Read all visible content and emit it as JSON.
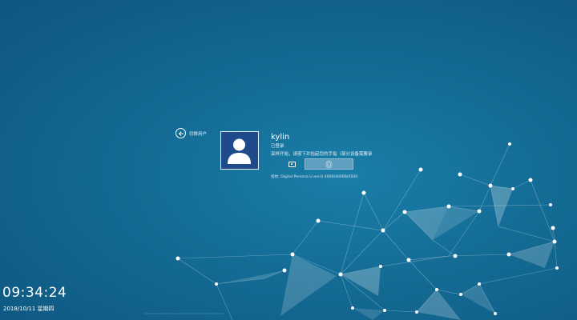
{
  "login": {
    "switch_user": "切换用户",
    "username": "kylin",
    "status": "已登录",
    "prompt": "采样开始，请按下并抬起您的手指（部分设备需要录",
    "device": "指纹: Digital Persona U.are.U 4000/4000B/4500"
  },
  "icons": {
    "back": "back-arrow-icon",
    "avatar": "user-avatar-icon",
    "camera": "camera-icon",
    "fingerprint": "fingerprint-icon"
  },
  "clock": {
    "time": "09:34:24",
    "date": "2018/10/11 星期四"
  },
  "colors": {
    "background": "#136a93",
    "avatar_bg": "#1f4a8c",
    "fingerprint_box": "#5e9ebe"
  }
}
